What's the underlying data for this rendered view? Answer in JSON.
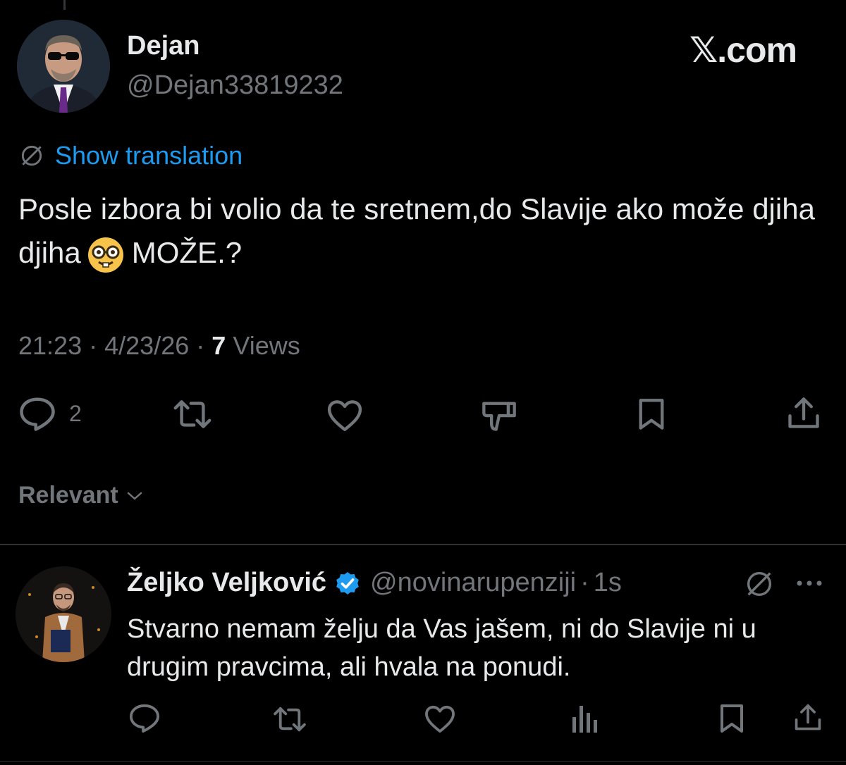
{
  "tweet": {
    "author_name": "Dejan",
    "author_handle": "@Dejan33819232",
    "site_logo": "𝕏.com",
    "translation_link": "Show translation",
    "text_before_emoji": "Posle izbora bi volio da te sretnem,do Slavije ako može djiha djiha",
    "emoji": "nerd-face-emoji",
    "text_after_emoji": "MOŽE.?",
    "time": "21:23",
    "date": "4/23/26",
    "views_count": "7",
    "views_label": "Views",
    "separator": "·",
    "reply_count": "2"
  },
  "sort": {
    "label": "Relevant"
  },
  "reply": {
    "author_name": "Željko Veljković",
    "author_handle": "@novinarupenziji",
    "age": "1s",
    "separator": "·",
    "text": "Stvarno nemam želju da Vas jašem, ni do Slavije ni u drugim pravcima, ali hvala na ponudi."
  },
  "colors": {
    "background": "#000000",
    "text": "#e7e9ea",
    "muted": "#71767b",
    "accent": "#1d9bf0",
    "divider": "#2f3336"
  },
  "icons": [
    "reply-icon",
    "retweet-icon",
    "like-icon",
    "dislike-icon",
    "bookmark-icon",
    "share-icon",
    "views-icon",
    "translate-icon",
    "verified-badge-icon",
    "more-icon",
    "chevron-down-icon"
  ]
}
